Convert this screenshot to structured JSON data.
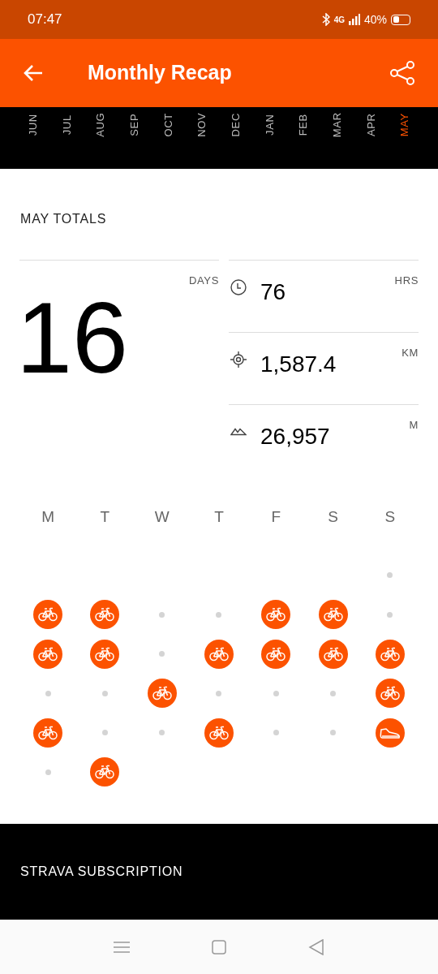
{
  "status_bar": {
    "time": "07:47",
    "network": "4G",
    "battery": "40%"
  },
  "header": {
    "title": "Monthly Recap"
  },
  "months": [
    {
      "label": "JUN",
      "selected": false
    },
    {
      "label": "JUL",
      "selected": false
    },
    {
      "label": "AUG",
      "selected": false
    },
    {
      "label": "SEP",
      "selected": false
    },
    {
      "label": "OCT",
      "selected": false
    },
    {
      "label": "NOV",
      "selected": false
    },
    {
      "label": "DEC",
      "selected": false
    },
    {
      "label": "JAN",
      "selected": false
    },
    {
      "label": "FEB",
      "selected": false
    },
    {
      "label": "MAR",
      "selected": false
    },
    {
      "label": "APR",
      "selected": false
    },
    {
      "label": "MAY",
      "selected": true
    }
  ],
  "totals": {
    "title": "MAY TOTALS",
    "days": {
      "value": "16",
      "unit": "DAYS"
    },
    "stats": [
      {
        "kind": "time",
        "value": "76",
        "unit": "HRS"
      },
      {
        "kind": "distance",
        "value": "1,587.4",
        "unit": "KM"
      },
      {
        "kind": "elevation",
        "value": "26,957",
        "unit": "M"
      }
    ]
  },
  "calendar": {
    "weekdays": [
      "M",
      "T",
      "W",
      "T",
      "F",
      "S",
      "S"
    ],
    "weeks": [
      [
        {
          "kind": "blank"
        },
        {
          "kind": "blank"
        },
        {
          "kind": "blank"
        },
        {
          "kind": "blank"
        },
        {
          "kind": "blank"
        },
        {
          "kind": "blank"
        },
        {
          "kind": "rest"
        }
      ],
      [
        {
          "kind": "ride"
        },
        {
          "kind": "ride"
        },
        {
          "kind": "rest"
        },
        {
          "kind": "rest"
        },
        {
          "kind": "ride"
        },
        {
          "kind": "ride"
        },
        {
          "kind": "rest"
        }
      ],
      [
        {
          "kind": "ride"
        },
        {
          "kind": "ride"
        },
        {
          "kind": "rest"
        },
        {
          "kind": "ride"
        },
        {
          "kind": "ride"
        },
        {
          "kind": "ride"
        },
        {
          "kind": "ride"
        }
      ],
      [
        {
          "kind": "rest"
        },
        {
          "kind": "rest"
        },
        {
          "kind": "ride"
        },
        {
          "kind": "rest"
        },
        {
          "kind": "rest"
        },
        {
          "kind": "rest"
        },
        {
          "kind": "ride"
        }
      ],
      [
        {
          "kind": "ride"
        },
        {
          "kind": "rest"
        },
        {
          "kind": "rest"
        },
        {
          "kind": "ride"
        },
        {
          "kind": "rest"
        },
        {
          "kind": "rest"
        },
        {
          "kind": "run"
        }
      ],
      [
        {
          "kind": "rest"
        },
        {
          "kind": "ride"
        }
      ]
    ]
  },
  "subscription": {
    "title": "STRAVA SUBSCRIPTION"
  }
}
